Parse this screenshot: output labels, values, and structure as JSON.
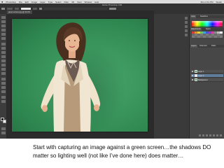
{
  "menubar": {
    "apple": "",
    "items": [
      "Photoshop",
      "File",
      "Edit",
      "Image",
      "Layer",
      "Type",
      "Select",
      "Filter",
      "3D",
      "View",
      "Window",
      "Help"
    ],
    "right": [
      "Mon 2:41 PM",
      "Studio"
    ]
  },
  "window": {
    "title": "Adobe Photoshop CS6"
  },
  "document_tab": {
    "label": "green-screen.jpg @ 33.3%"
  },
  "panels": {
    "color_tabs": [
      "Color",
      "Swatches"
    ],
    "adjust_tabs": [
      "Adjustments",
      "Styles"
    ],
    "layers_tabs": [
      "Layers",
      "Channels",
      "Paths"
    ],
    "layers": [
      {
        "name": "Layer 1",
        "thumb": "green",
        "selected": false
      },
      {
        "name": "Layer 2",
        "thumb": "white",
        "selected": true
      },
      {
        "name": "Background",
        "thumb": "green",
        "selected": false
      }
    ]
  },
  "colors": {
    "green_screen": "#3c985e",
    "app_chrome": "#323232",
    "panel_bg": "#474747"
  },
  "caption": {
    "line1": "Start with capturing an image against a green screen…the shadows DO",
    "line2": "matter so lighting well (not like I’ve done here) does matter…"
  }
}
